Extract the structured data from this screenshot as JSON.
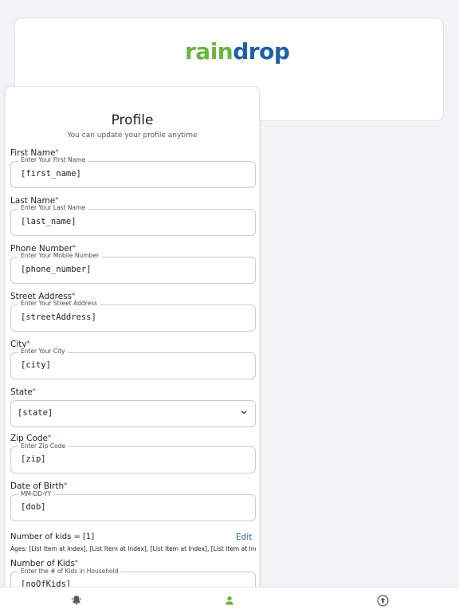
{
  "brand": {
    "logo_part1": "rain",
    "logo_part2": "drop"
  },
  "profile": {
    "title": "Profile",
    "subtitle": "You can update your profile anytime",
    "required_marker": "*",
    "fields": [
      {
        "label": "First Name",
        "legend": "Enter Your First Name",
        "value": "[first_name]"
      },
      {
        "label": "Last Name",
        "legend": "Enter Your Last Name",
        "value": "[last_name]"
      },
      {
        "label": "Phone Number",
        "legend": "Enter Your Mobile Number",
        "value": "[phone_number]"
      },
      {
        "label": "Street Address",
        "legend": "Enter Your Street Address",
        "value": "[streetAddress]"
      },
      {
        "label": "City",
        "legend": "Enter Your City",
        "value": "[city]"
      },
      {
        "label": "State",
        "value": "[state]"
      },
      {
        "label": "Zip Code",
        "legend": "Enter Zip Code",
        "value": "[zip]"
      },
      {
        "label": "Date of Birth",
        "legend": "MM-DD-YY",
        "value": "[dob]"
      },
      {
        "label": "Number of Kids",
        "legend": "Enter the # of Kids in Household",
        "value": "[noOfKids]"
      }
    ],
    "kids_count_text": "Number of kids = [1]",
    "edit_label": "Edit",
    "ages_text": "Ages:  [List Item at Index], [List Item at Index], [List Item at Index], [List Item at Index]"
  },
  "nav": {
    "items": [
      {
        "icon": "bell-icon"
      },
      {
        "icon": "person-icon",
        "active": true
      },
      {
        "icon": "upload-circle-icon"
      }
    ],
    "active_color": "#6cb33f",
    "inactive_color": "#555555"
  }
}
